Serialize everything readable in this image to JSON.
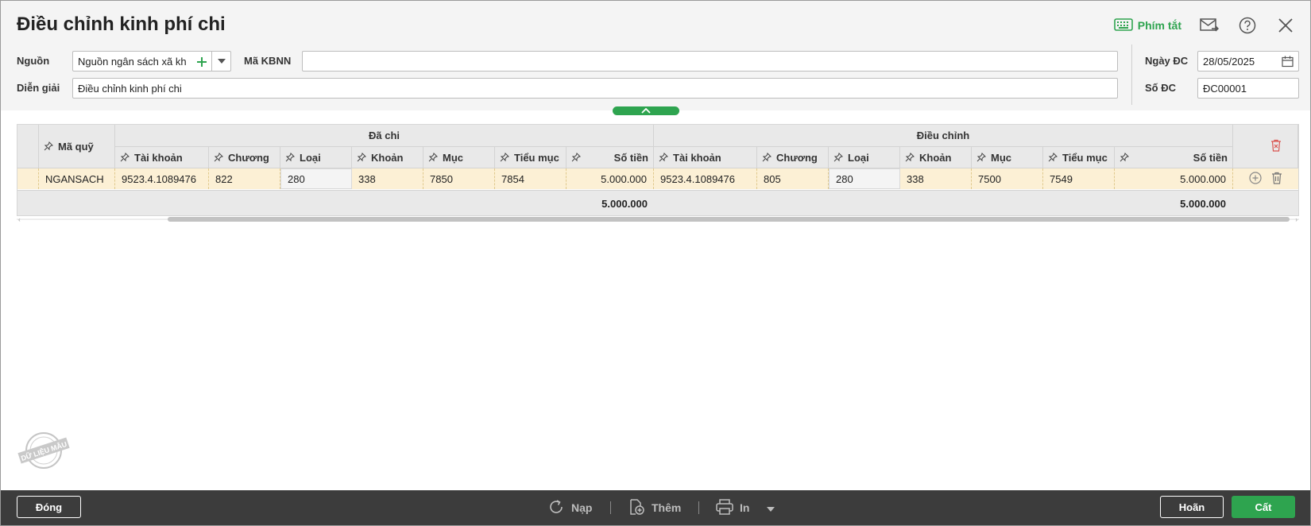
{
  "window": {
    "title": "Điều chỉnh kinh phí chi"
  },
  "top_actions": {
    "shortcut_label": "Phím tắt"
  },
  "form": {
    "nguon_label": "Nguồn",
    "nguon_value": "Nguồn ngân sách xã kh",
    "ma_kbnn_label": "Mã KBNN",
    "ma_kbnn_value": "",
    "dien_giai_label": "Diễn giải",
    "dien_giai_value": "Điều chỉnh kinh phí chi",
    "ngay_dc_label": "Ngày ĐC",
    "ngay_dc_value": "28/05/2025",
    "so_dc_label": "Số ĐC",
    "so_dc_value": "ĐC00001"
  },
  "grid": {
    "group_headers": {
      "da_chi": "Đã chi",
      "dieu_chinh": "Điều chỉnh"
    },
    "columns": {
      "ma_quy": "Mã quỹ",
      "tai_khoan": "Tài khoản",
      "chuong": "Chương",
      "loai": "Loại",
      "khoan": "Khoản",
      "muc": "Mục",
      "tieu_muc": "Tiểu mục",
      "so_tien": "Số tiền"
    },
    "row": {
      "ma_quy": "NGANSACH",
      "dc_tai_khoan": "9523.4.1089476",
      "dc_chuong": "822",
      "dc_loai": "280",
      "dc_khoan": "338",
      "dc_muc": "7850",
      "dc_tieu_muc": "7854",
      "dc_so_tien": "5.000.000",
      "adj_tai_khoan": "9523.4.1089476",
      "adj_chuong": "805",
      "adj_loai": "280",
      "adj_khoan": "338",
      "adj_muc": "7500",
      "adj_tieu_muc": "7549",
      "adj_so_tien": "5.000.000"
    },
    "totals": {
      "da_chi": "5.000.000",
      "dieu_chinh": "5.000.000"
    }
  },
  "watermark": "DỮ LIỆU MẪU",
  "footer": {
    "close_label": "Đóng",
    "reload_label": "Nạp",
    "add_label": "Thêm",
    "print_label": "In",
    "cancel_label": "Hoãn",
    "save_label": "Cất"
  },
  "colors": {
    "accent": "#2ea44f",
    "row_highlight": "#fcf0d5",
    "footer_bg": "#3c3c3c"
  }
}
